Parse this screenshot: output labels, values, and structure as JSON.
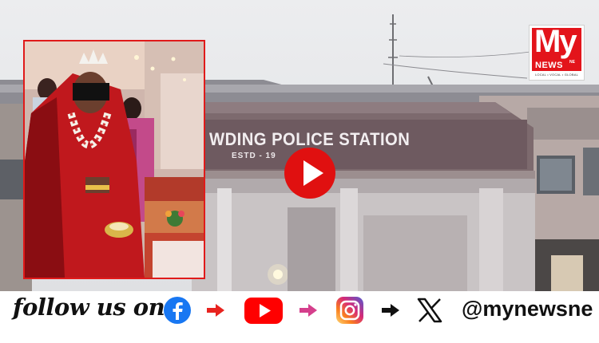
{
  "sign": {
    "title": "WDING POLICE STATION",
    "estd": "ESTD - 19"
  },
  "logo": {
    "my": "My",
    "news": "NEWS",
    "ne": "NE",
    "tagline": "LOCAL • VOCAL • GLOBAL"
  },
  "footer": {
    "follow_text": "follow us on",
    "handle": "@mynewsne",
    "platforms": [
      "facebook-icon",
      "youtube-icon",
      "instagram-icon",
      "x-icon"
    ]
  },
  "colors": {
    "brand_red": "#e3141b",
    "play_red": "#e01010",
    "facebook_blue": "#1877f2",
    "youtube_red": "#ff0000",
    "arrow_red": "#e8231f",
    "arrow_pink": "#d53f8c"
  }
}
